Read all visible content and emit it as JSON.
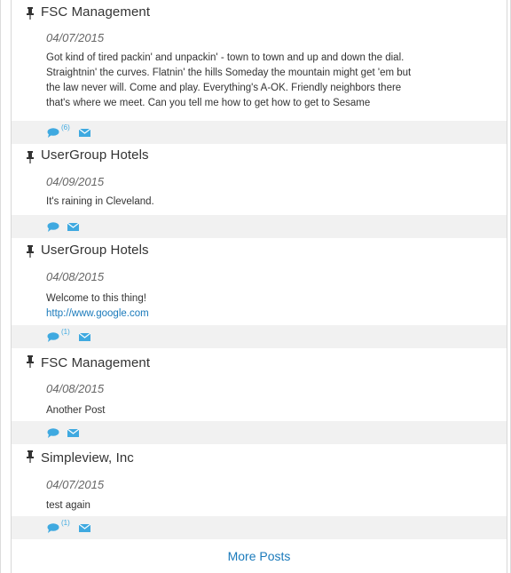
{
  "posts": [
    {
      "author": "FSC Management",
      "date": "04/07/2015",
      "body_lines": [
        "Got kind of tired packin' and unpackin' - town to town and up and down the dial.",
        "Straightnin' the curves. Flatnin' the hills Someday the mountain might get 'em but",
        "the law never will. Come and play. Everything's A-OK. Friendly neighbors there",
        "that's where we meet. Can you tell me how to get how to get to Sesame"
      ],
      "comment_count": "(6)"
    },
    {
      "author": "UserGroup Hotels",
      "date": "04/09/2015",
      "body_lines": [
        "It's raining in Cleveland."
      ],
      "comment_count": ""
    },
    {
      "author": "UserGroup Hotels",
      "date": "04/08/2015",
      "body_lines": [
        "Welcome to this thing!"
      ],
      "link": "http://www.google.com",
      "comment_count": "(1)"
    },
    {
      "author": "FSC Management",
      "date": "04/08/2015",
      "body_lines": [
        "Another Post"
      ],
      "comment_count": ""
    },
    {
      "author": "Simpleview, Inc",
      "date": "04/07/2015",
      "body_lines": [
        "test again"
      ],
      "comment_count": "(1)"
    }
  ],
  "more_label": "More Posts",
  "colors": {
    "accent": "#3fa9e0",
    "link": "#1a7abb",
    "action_bar": "#f1f1f1"
  },
  "icons": [
    "pin-icon",
    "comment-icon",
    "mail-icon"
  ]
}
